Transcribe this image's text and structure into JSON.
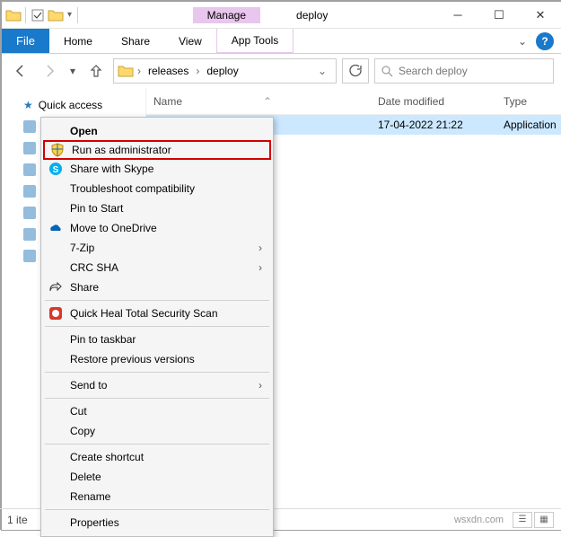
{
  "title": {
    "manage": "Manage",
    "window": "deploy"
  },
  "ribbon": {
    "file": "File",
    "home": "Home",
    "share": "Share",
    "view": "View",
    "apptools": "App Tools"
  },
  "breadcrumb": {
    "items": [
      "releases",
      "deploy"
    ]
  },
  "search": {
    "placeholder": "Search deploy"
  },
  "columns": {
    "name": "Name",
    "date": "Date modified",
    "type": "Type"
  },
  "row": {
    "date": "17-04-2022 21:22",
    "type": "Application"
  },
  "sidebar": {
    "quick": "Quick access"
  },
  "context": {
    "open": "Open",
    "runas": "Run as administrator",
    "skype": "Share with Skype",
    "troubleshoot": "Troubleshoot compatibility",
    "pinstart": "Pin to Start",
    "onedrive": "Move to OneDrive",
    "sevenzip": "7-Zip",
    "crcsha": "CRC SHA",
    "share": "Share",
    "quickheal": "Quick Heal Total Security Scan",
    "pintaskbar": "Pin to taskbar",
    "restore": "Restore previous versions",
    "sendto": "Send to",
    "cut": "Cut",
    "copy": "Copy",
    "shortcut": "Create shortcut",
    "delete": "Delete",
    "rename": "Rename",
    "properties": "Properties"
  },
  "status": {
    "count": "1 ite",
    "watermark": "wsxdn.com"
  }
}
